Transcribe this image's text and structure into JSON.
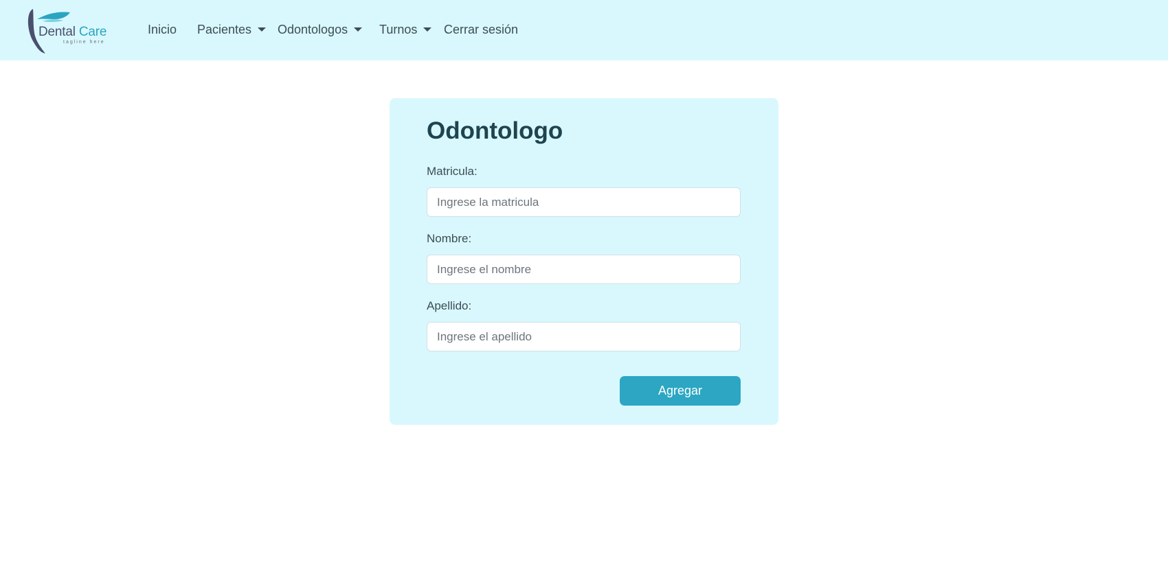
{
  "brand": {
    "name_part1": "Dental",
    "name_part2": "Care",
    "tagline": "tagline here"
  },
  "nav": {
    "items": [
      {
        "label": "Inicio",
        "has_dropdown": false
      },
      {
        "label": "Pacientes",
        "has_dropdown": true
      },
      {
        "label": "Odontologos",
        "has_dropdown": true
      },
      {
        "label": "Turnos",
        "has_dropdown": true
      },
      {
        "label": "Cerrar sesión",
        "has_dropdown": false
      }
    ]
  },
  "form": {
    "title": "Odontologo",
    "fields": [
      {
        "label": "Matricula:",
        "placeholder": "Ingrese la matricula",
        "value": ""
      },
      {
        "label": "Nombre:",
        "placeholder": "Ingrese el nombre",
        "value": ""
      },
      {
        "label": "Apellido:",
        "placeholder": "Ingrese el apellido",
        "value": ""
      }
    ],
    "submit_label": "Agregar"
  },
  "colors": {
    "navbar_bg": "#d9f8fd",
    "card_bg": "#d9f8fd",
    "accent": "#2ca6c3",
    "title": "#1e4450",
    "logo_dark": "#4a4f6e"
  }
}
